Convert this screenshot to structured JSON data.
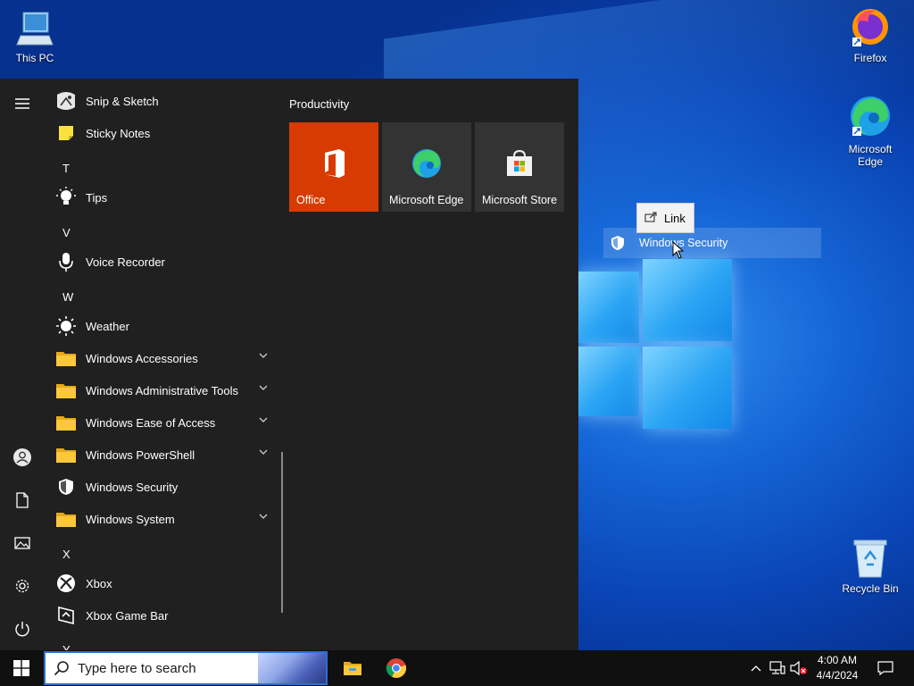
{
  "desktop": {
    "icons": [
      {
        "label": "This PC",
        "icon": "computer-icon"
      },
      {
        "label": "Firefox",
        "icon": "firefox-icon"
      },
      {
        "label": "Microsoft Edge",
        "icon": "edge-icon"
      },
      {
        "label": "Recycle Bin",
        "icon": "recycle-bin-icon"
      }
    ]
  },
  "start_menu": {
    "rail": [
      "menu-icon",
      "user-icon",
      "document-icon",
      "pictures-icon",
      "settings-icon",
      "power-icon"
    ],
    "apps": [
      {
        "label": "Snip & Sketch",
        "icon": "snip-sketch-icon"
      },
      {
        "label": "Sticky Notes",
        "icon": "sticky-notes-icon"
      },
      {
        "letter": "T"
      },
      {
        "label": "Tips",
        "icon": "tips-icon"
      },
      {
        "letter": "V"
      },
      {
        "label": "Voice Recorder",
        "icon": "voice-recorder-icon"
      },
      {
        "letter": "W"
      },
      {
        "label": "Weather",
        "icon": "weather-icon"
      },
      {
        "label": "Windows Accessories",
        "icon": "folder-icon",
        "expandable": true
      },
      {
        "label": "Windows Administrative Tools",
        "icon": "folder-icon",
        "expandable": true
      },
      {
        "label": "Windows Ease of Access",
        "icon": "folder-icon",
        "expandable": true
      },
      {
        "label": "Windows PowerShell",
        "icon": "folder-icon",
        "expandable": true
      },
      {
        "label": "Windows Security",
        "icon": "shield-icon"
      },
      {
        "label": "Windows System",
        "icon": "folder-icon",
        "expandable": true
      },
      {
        "letter": "X"
      },
      {
        "label": "Xbox",
        "icon": "xbox-icon"
      },
      {
        "label": "Xbox Game Bar",
        "icon": "xbox-game-bar-icon"
      },
      {
        "letter": "Y"
      }
    ],
    "tiles_group": "Productivity",
    "tiles": [
      {
        "label": "Office",
        "icon": "office-icon",
        "color": "#d83b01"
      },
      {
        "label": "Microsoft Edge",
        "icon": "edge-icon",
        "color": "#333333"
      },
      {
        "label": "Microsoft Store",
        "icon": "store-icon",
        "color": "#333333"
      }
    ]
  },
  "drag": {
    "ghost_label": "Windows Security",
    "tooltip": "Link"
  },
  "taskbar": {
    "search_placeholder": "Type here to search",
    "apps": [
      "file-explorer-icon",
      "chrome-icon"
    ],
    "time": "4:00 AM",
    "date": "4/4/2024"
  },
  "colors": {
    "start_bg": "#202020",
    "taskbar_bg": "#101010",
    "office_tile": "#d83b01",
    "accent": "#0078d7"
  }
}
